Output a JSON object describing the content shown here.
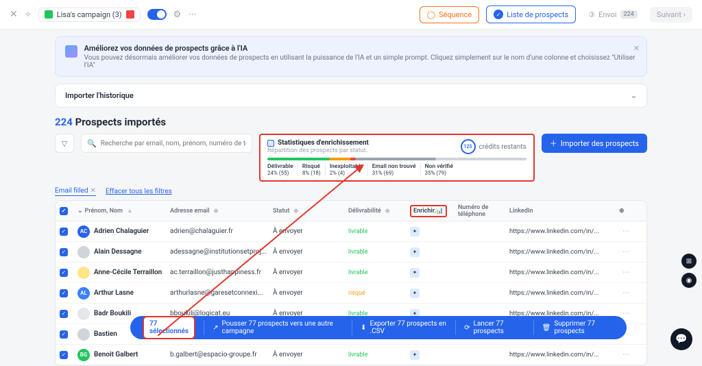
{
  "topbar": {
    "campaign_name": "Lisa's campaign (3)",
    "seq": "Séquence",
    "list": "Liste de prospects",
    "send": "Envoi",
    "send_badge": "224",
    "next": "Suivant ›"
  },
  "banner": {
    "title": "Améliorez vos données de prospects grâce à l'IA",
    "subtitle": "Vous pouvez désormais améliorer vos données de prospects en utilisant la puissance de l'IA et un simple prompt. Cliquez simplement sur le nom d'une colonne et choisissez \"Utiliser l'IA\""
  },
  "accordion": "Importer l'historique",
  "heading": {
    "count": "224",
    "text": "Prospects importés"
  },
  "search_placeholder": "Recherche par email, nom, prénom, numéro de téléph",
  "stats": {
    "title": "Statistiques d'enrichissement",
    "subtitle": "Répartition des prospects par statut.",
    "credits_value": "125",
    "credits_label": "crédits restants",
    "legend": [
      {
        "l": "Délivrable",
        "v": "24% (55)"
      },
      {
        "l": "Risqué",
        "v": "8% (18)"
      },
      {
        "l": "Inexploitable",
        "v": "2% (4)"
      },
      {
        "l": "Email non trouvé",
        "v": "31% (69)"
      },
      {
        "l": "Non vérifié",
        "v": "35% (79)"
      }
    ]
  },
  "import_btn": "Importer des prospects",
  "filter_pill": "Email filled",
  "clear_filters": "Effacer tous les filtres",
  "columns": {
    "name": "Prénom, Nom",
    "email": "Adresse email",
    "status": "Statut",
    "deliv": "Délivrabilité",
    "enrich": "Enrichir.",
    "phone": "Numéro de téléphone",
    "linkedin": "LinkedIn"
  },
  "rows": [
    {
      "av": "AC",
      "col": "#2563eb",
      "name": "Adrien Chalaguier",
      "email": "adrien@chalaguier.fr",
      "status": "À envoyer",
      "deliv": "livrable",
      "dclass": "ok",
      "linkedin": "https://www.linkedin.com/in/..."
    },
    {
      "av": "",
      "col": "#d1d5db",
      "name": "Alain Dessagne",
      "email": "adessagne@institutionsetproj...",
      "status": "À envoyer",
      "deliv": "livrable",
      "dclass": "ok",
      "linkedin": "https://www.linkedin.com/in/..."
    },
    {
      "av": "",
      "col": "#fde68a",
      "name": "Anne-Cécile Terraillon",
      "email": "ac.terraillon@justhappiness.fr",
      "status": "À envoyer",
      "deliv": "livrable",
      "dclass": "ok",
      "linkedin": "https://www.linkedin.com/in/..."
    },
    {
      "av": "AL",
      "col": "#3b82f6",
      "name": "Arthur Lasne",
      "email": "arthurlasne@garesetconnexi...",
      "status": "À envoyer",
      "deliv": "risqué",
      "dclass": "risk",
      "linkedin": "https://www.linkedin.com/in/..."
    },
    {
      "av": "",
      "col": "#e5e7eb",
      "name": "Badr Boukili",
      "email": "bboukili@logicat.eu",
      "status": "À envoyer",
      "deliv": "livrable",
      "dclass": "ok",
      "linkedin": "https://www.linkedin.com/in/..."
    },
    {
      "av": "",
      "col": "#d1d5db",
      "name": "Bastien",
      "email": "",
      "status": "",
      "deliv": "",
      "dclass": "ok",
      "linkedin": ""
    },
    {
      "av": "BG",
      "col": "#22c55e",
      "name": "Benoit Galbert",
      "email": "b.galbert@espacio-groupe.fr",
      "status": "À envoyer",
      "deliv": "livrable",
      "dclass": "ok",
      "linkedin": "https://www.linkedin.com/in/..."
    }
  ],
  "actionbar": {
    "selected": "77 sélectionnés",
    "push": "Pousser 77 prospects vers une autre campagne",
    "export": "Exporter 77 prospects en .CSV",
    "launch": "Lancer 77 prospects",
    "delete": "Supprimer 77 prospects"
  }
}
